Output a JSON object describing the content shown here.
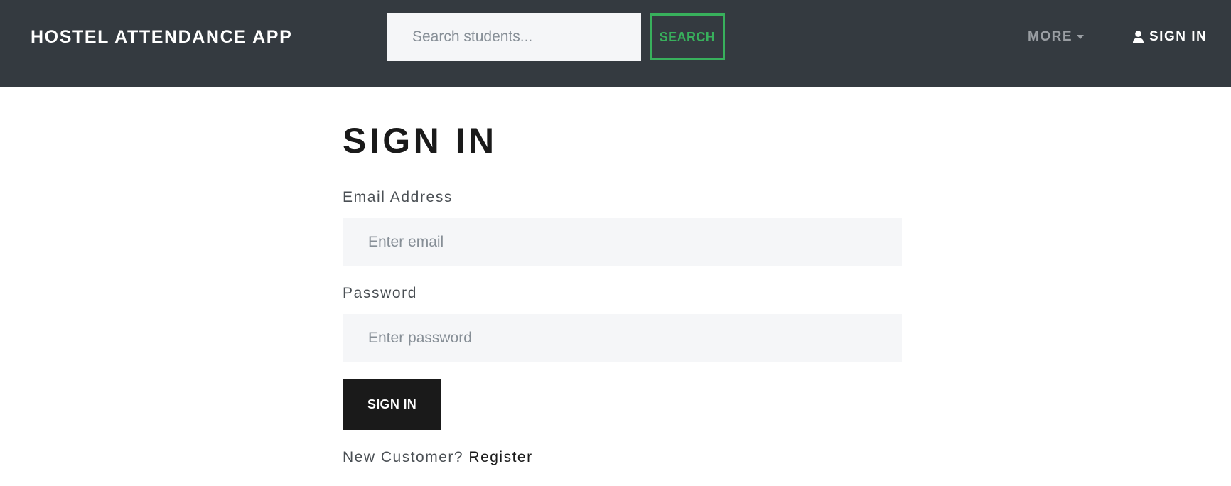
{
  "navbar": {
    "brand": "HOSTEL ATTENDANCE APP",
    "search": {
      "placeholder": "Search students...",
      "value": ""
    },
    "search_button": "SEARCH",
    "more_label": "MORE",
    "sign_in_label": "SIGN IN",
    "icons": {
      "user": "user-icon",
      "more": "chevron-down-icon"
    }
  },
  "form": {
    "title": "SIGN IN",
    "email_label": "Email Address",
    "email_placeholder": "Enter email",
    "email_value": "",
    "password_label": "Password",
    "password_placeholder": "Enter password",
    "password_value": "",
    "submit_label": "SIGN IN",
    "register_prompt": "New Customer?",
    "register_link": "Register"
  },
  "colors": {
    "navbar_bg": "#343a40",
    "accent_green": "#38b05c",
    "button_dark": "#1a1a1a",
    "input_bg": "#f5f6f8"
  }
}
